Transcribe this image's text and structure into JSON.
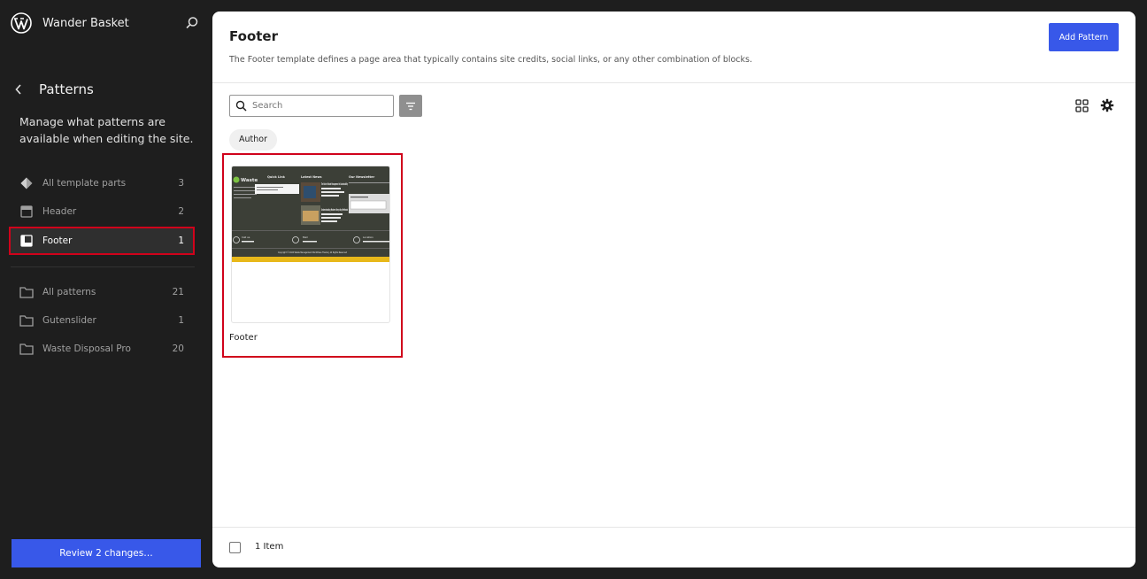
{
  "site": {
    "name": "Wander Basket"
  },
  "sidebar": {
    "title": "Patterns",
    "description": "Manage what patterns are available when editing the site.",
    "template_parts": [
      {
        "label": "All template parts",
        "count": "3",
        "icon": "diamond-icon"
      },
      {
        "label": "Header",
        "count": "2",
        "icon": "header-layout-icon"
      },
      {
        "label": "Footer",
        "count": "1",
        "icon": "footer-layout-icon",
        "active": true
      }
    ],
    "categories": [
      {
        "label": "All patterns",
        "count": "21",
        "icon": "folder-icon"
      },
      {
        "label": "Gutenslider",
        "count": "1",
        "icon": "folder-icon"
      },
      {
        "label": "Waste Disposal Pro",
        "count": "20",
        "icon": "folder-icon"
      }
    ],
    "review_label": "Review 2 changes…"
  },
  "main": {
    "title": "Footer",
    "description": "The Footer template defines a page area that typically contains site credits, social links, or any other combination of blocks.",
    "add_button": "Add Pattern",
    "search_placeholder": "Search",
    "filter_chip": "Author",
    "pattern": {
      "label": "Footer",
      "thumbnail": {
        "logo": "Waste",
        "headings": [
          "Quick Link",
          "Latest News",
          "Our Newsletter"
        ],
        "news": [
          "The Role of Waste Management in Sustainability",
          "Understanding Modern Recycling Methods"
        ],
        "contacts": [
          "Call us",
          "Mail",
          "Location"
        ],
        "copyright": "Copyright © 2024 Waste Management WordPress Theme | All Rights Reserved"
      }
    },
    "item_count": "1 Item"
  },
  "colors": {
    "accent": "#3858e9",
    "highlight": "#d0021b",
    "sidebar_bg": "#1e1e1e",
    "thumb_bg": "#3c3f37",
    "thumb_strip": "#e8b81a"
  }
}
